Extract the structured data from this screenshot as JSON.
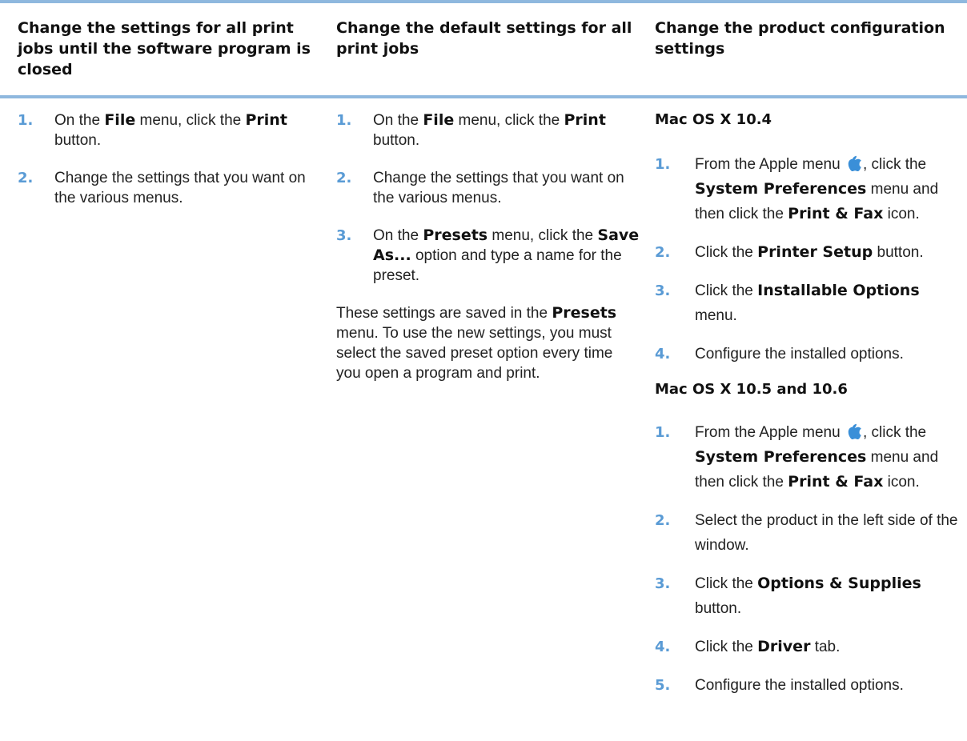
{
  "headers": [
    "Change the settings for all print jobs until the software program is closed",
    "Change the default settings for all print jobs",
    "Change the product configuration settings"
  ],
  "col1": {
    "steps": [
      {
        "num": "1.",
        "parts": [
          "On the ",
          "File",
          " menu, click the ",
          "Print",
          " button."
        ]
      },
      {
        "num": "2.",
        "text": "Change the settings that you want on the various menus."
      }
    ]
  },
  "col2": {
    "steps": [
      {
        "num": "1.",
        "parts": [
          "On the ",
          "File",
          " menu, click the ",
          "Print",
          " button."
        ]
      },
      {
        "num": "2.",
        "text": "Change the settings that you want on the various menus."
      },
      {
        "num": "3.",
        "parts": [
          "On the ",
          "Presets",
          " menu, click the ",
          "Save As...",
          " option and type a name for the preset."
        ]
      }
    ],
    "note": [
      "These settings are saved in the ",
      "Presets",
      " menu. To use the new settings, you must select the saved preset option every time you open a program and print."
    ]
  },
  "col3": {
    "section1": {
      "title": "Mac OS X 10.4",
      "steps": [
        {
          "num": "1.",
          "parts": [
            "From the Apple menu ",
            ", click the ",
            "System Preferences",
            " menu and then click the ",
            "Print & Fax",
            " icon."
          ]
        },
        {
          "num": "2.",
          "parts": [
            "Click the ",
            "Printer Setup",
            " button."
          ]
        },
        {
          "num": "3.",
          "parts": [
            "Click the ",
            "Installable Options",
            " menu."
          ]
        },
        {
          "num": "4.",
          "text": "Configure the installed options."
        }
      ]
    },
    "section2": {
      "title": "Mac OS X 10.5 and 10.6",
      "steps": [
        {
          "num": "1.",
          "parts": [
            "From the Apple menu ",
            ", click the ",
            "System Preferences",
            " menu and then click the ",
            "Print & Fax",
            " icon."
          ]
        },
        {
          "num": "2.",
          "text": "Select the product in the left side of the window."
        },
        {
          "num": "3.",
          "parts": [
            "Click the ",
            "Options & Supplies",
            " button."
          ]
        },
        {
          "num": "4.",
          "parts": [
            "Click the ",
            "Driver",
            " tab."
          ]
        },
        {
          "num": "5.",
          "text": "Configure the installed options."
        }
      ]
    }
  },
  "colors": {
    "accent": "#5a9bd5",
    "rule": "#8fb8de"
  },
  "icons": [
    "apple-icon"
  ]
}
